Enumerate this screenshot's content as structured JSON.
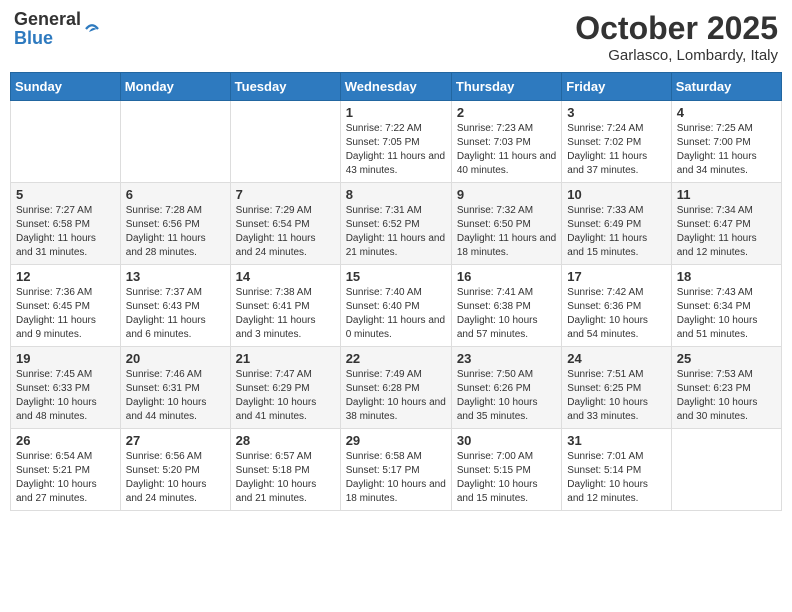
{
  "header": {
    "logo_general": "General",
    "logo_blue": "Blue",
    "month": "October 2025",
    "location": "Garlasco, Lombardy, Italy"
  },
  "weekdays": [
    "Sunday",
    "Monday",
    "Tuesday",
    "Wednesday",
    "Thursday",
    "Friday",
    "Saturday"
  ],
  "rows": [
    [
      {
        "day": "",
        "sunrise": "",
        "sunset": "",
        "daylight": ""
      },
      {
        "day": "",
        "sunrise": "",
        "sunset": "",
        "daylight": ""
      },
      {
        "day": "",
        "sunrise": "",
        "sunset": "",
        "daylight": ""
      },
      {
        "day": "1",
        "sunrise": "Sunrise: 7:22 AM",
        "sunset": "Sunset: 7:05 PM",
        "daylight": "Daylight: 11 hours and 43 minutes."
      },
      {
        "day": "2",
        "sunrise": "Sunrise: 7:23 AM",
        "sunset": "Sunset: 7:03 PM",
        "daylight": "Daylight: 11 hours and 40 minutes."
      },
      {
        "day": "3",
        "sunrise": "Sunrise: 7:24 AM",
        "sunset": "Sunset: 7:02 PM",
        "daylight": "Daylight: 11 hours and 37 minutes."
      },
      {
        "day": "4",
        "sunrise": "Sunrise: 7:25 AM",
        "sunset": "Sunset: 7:00 PM",
        "daylight": "Daylight: 11 hours and 34 minutes."
      }
    ],
    [
      {
        "day": "5",
        "sunrise": "Sunrise: 7:27 AM",
        "sunset": "Sunset: 6:58 PM",
        "daylight": "Daylight: 11 hours and 31 minutes."
      },
      {
        "day": "6",
        "sunrise": "Sunrise: 7:28 AM",
        "sunset": "Sunset: 6:56 PM",
        "daylight": "Daylight: 11 hours and 28 minutes."
      },
      {
        "day": "7",
        "sunrise": "Sunrise: 7:29 AM",
        "sunset": "Sunset: 6:54 PM",
        "daylight": "Daylight: 11 hours and 24 minutes."
      },
      {
        "day": "8",
        "sunrise": "Sunrise: 7:31 AM",
        "sunset": "Sunset: 6:52 PM",
        "daylight": "Daylight: 11 hours and 21 minutes."
      },
      {
        "day": "9",
        "sunrise": "Sunrise: 7:32 AM",
        "sunset": "Sunset: 6:50 PM",
        "daylight": "Daylight: 11 hours and 18 minutes."
      },
      {
        "day": "10",
        "sunrise": "Sunrise: 7:33 AM",
        "sunset": "Sunset: 6:49 PM",
        "daylight": "Daylight: 11 hours and 15 minutes."
      },
      {
        "day": "11",
        "sunrise": "Sunrise: 7:34 AM",
        "sunset": "Sunset: 6:47 PM",
        "daylight": "Daylight: 11 hours and 12 minutes."
      }
    ],
    [
      {
        "day": "12",
        "sunrise": "Sunrise: 7:36 AM",
        "sunset": "Sunset: 6:45 PM",
        "daylight": "Daylight: 11 hours and 9 minutes."
      },
      {
        "day": "13",
        "sunrise": "Sunrise: 7:37 AM",
        "sunset": "Sunset: 6:43 PM",
        "daylight": "Daylight: 11 hours and 6 minutes."
      },
      {
        "day": "14",
        "sunrise": "Sunrise: 7:38 AM",
        "sunset": "Sunset: 6:41 PM",
        "daylight": "Daylight: 11 hours and 3 minutes."
      },
      {
        "day": "15",
        "sunrise": "Sunrise: 7:40 AM",
        "sunset": "Sunset: 6:40 PM",
        "daylight": "Daylight: 11 hours and 0 minutes."
      },
      {
        "day": "16",
        "sunrise": "Sunrise: 7:41 AM",
        "sunset": "Sunset: 6:38 PM",
        "daylight": "Daylight: 10 hours and 57 minutes."
      },
      {
        "day": "17",
        "sunrise": "Sunrise: 7:42 AM",
        "sunset": "Sunset: 6:36 PM",
        "daylight": "Daylight: 10 hours and 54 minutes."
      },
      {
        "day": "18",
        "sunrise": "Sunrise: 7:43 AM",
        "sunset": "Sunset: 6:34 PM",
        "daylight": "Daylight: 10 hours and 51 minutes."
      }
    ],
    [
      {
        "day": "19",
        "sunrise": "Sunrise: 7:45 AM",
        "sunset": "Sunset: 6:33 PM",
        "daylight": "Daylight: 10 hours and 48 minutes."
      },
      {
        "day": "20",
        "sunrise": "Sunrise: 7:46 AM",
        "sunset": "Sunset: 6:31 PM",
        "daylight": "Daylight: 10 hours and 44 minutes."
      },
      {
        "day": "21",
        "sunrise": "Sunrise: 7:47 AM",
        "sunset": "Sunset: 6:29 PM",
        "daylight": "Daylight: 10 hours and 41 minutes."
      },
      {
        "day": "22",
        "sunrise": "Sunrise: 7:49 AM",
        "sunset": "Sunset: 6:28 PM",
        "daylight": "Daylight: 10 hours and 38 minutes."
      },
      {
        "day": "23",
        "sunrise": "Sunrise: 7:50 AM",
        "sunset": "Sunset: 6:26 PM",
        "daylight": "Daylight: 10 hours and 35 minutes."
      },
      {
        "day": "24",
        "sunrise": "Sunrise: 7:51 AM",
        "sunset": "Sunset: 6:25 PM",
        "daylight": "Daylight: 10 hours and 33 minutes."
      },
      {
        "day": "25",
        "sunrise": "Sunrise: 7:53 AM",
        "sunset": "Sunset: 6:23 PM",
        "daylight": "Daylight: 10 hours and 30 minutes."
      }
    ],
    [
      {
        "day": "26",
        "sunrise": "Sunrise: 6:54 AM",
        "sunset": "Sunset: 5:21 PM",
        "daylight": "Daylight: 10 hours and 27 minutes."
      },
      {
        "day": "27",
        "sunrise": "Sunrise: 6:56 AM",
        "sunset": "Sunset: 5:20 PM",
        "daylight": "Daylight: 10 hours and 24 minutes."
      },
      {
        "day": "28",
        "sunrise": "Sunrise: 6:57 AM",
        "sunset": "Sunset: 5:18 PM",
        "daylight": "Daylight: 10 hours and 21 minutes."
      },
      {
        "day": "29",
        "sunrise": "Sunrise: 6:58 AM",
        "sunset": "Sunset: 5:17 PM",
        "daylight": "Daylight: 10 hours and 18 minutes."
      },
      {
        "day": "30",
        "sunrise": "Sunrise: 7:00 AM",
        "sunset": "Sunset: 5:15 PM",
        "daylight": "Daylight: 10 hours and 15 minutes."
      },
      {
        "day": "31",
        "sunrise": "Sunrise: 7:01 AM",
        "sunset": "Sunset: 5:14 PM",
        "daylight": "Daylight: 10 hours and 12 minutes."
      },
      {
        "day": "",
        "sunrise": "",
        "sunset": "",
        "daylight": ""
      }
    ]
  ]
}
